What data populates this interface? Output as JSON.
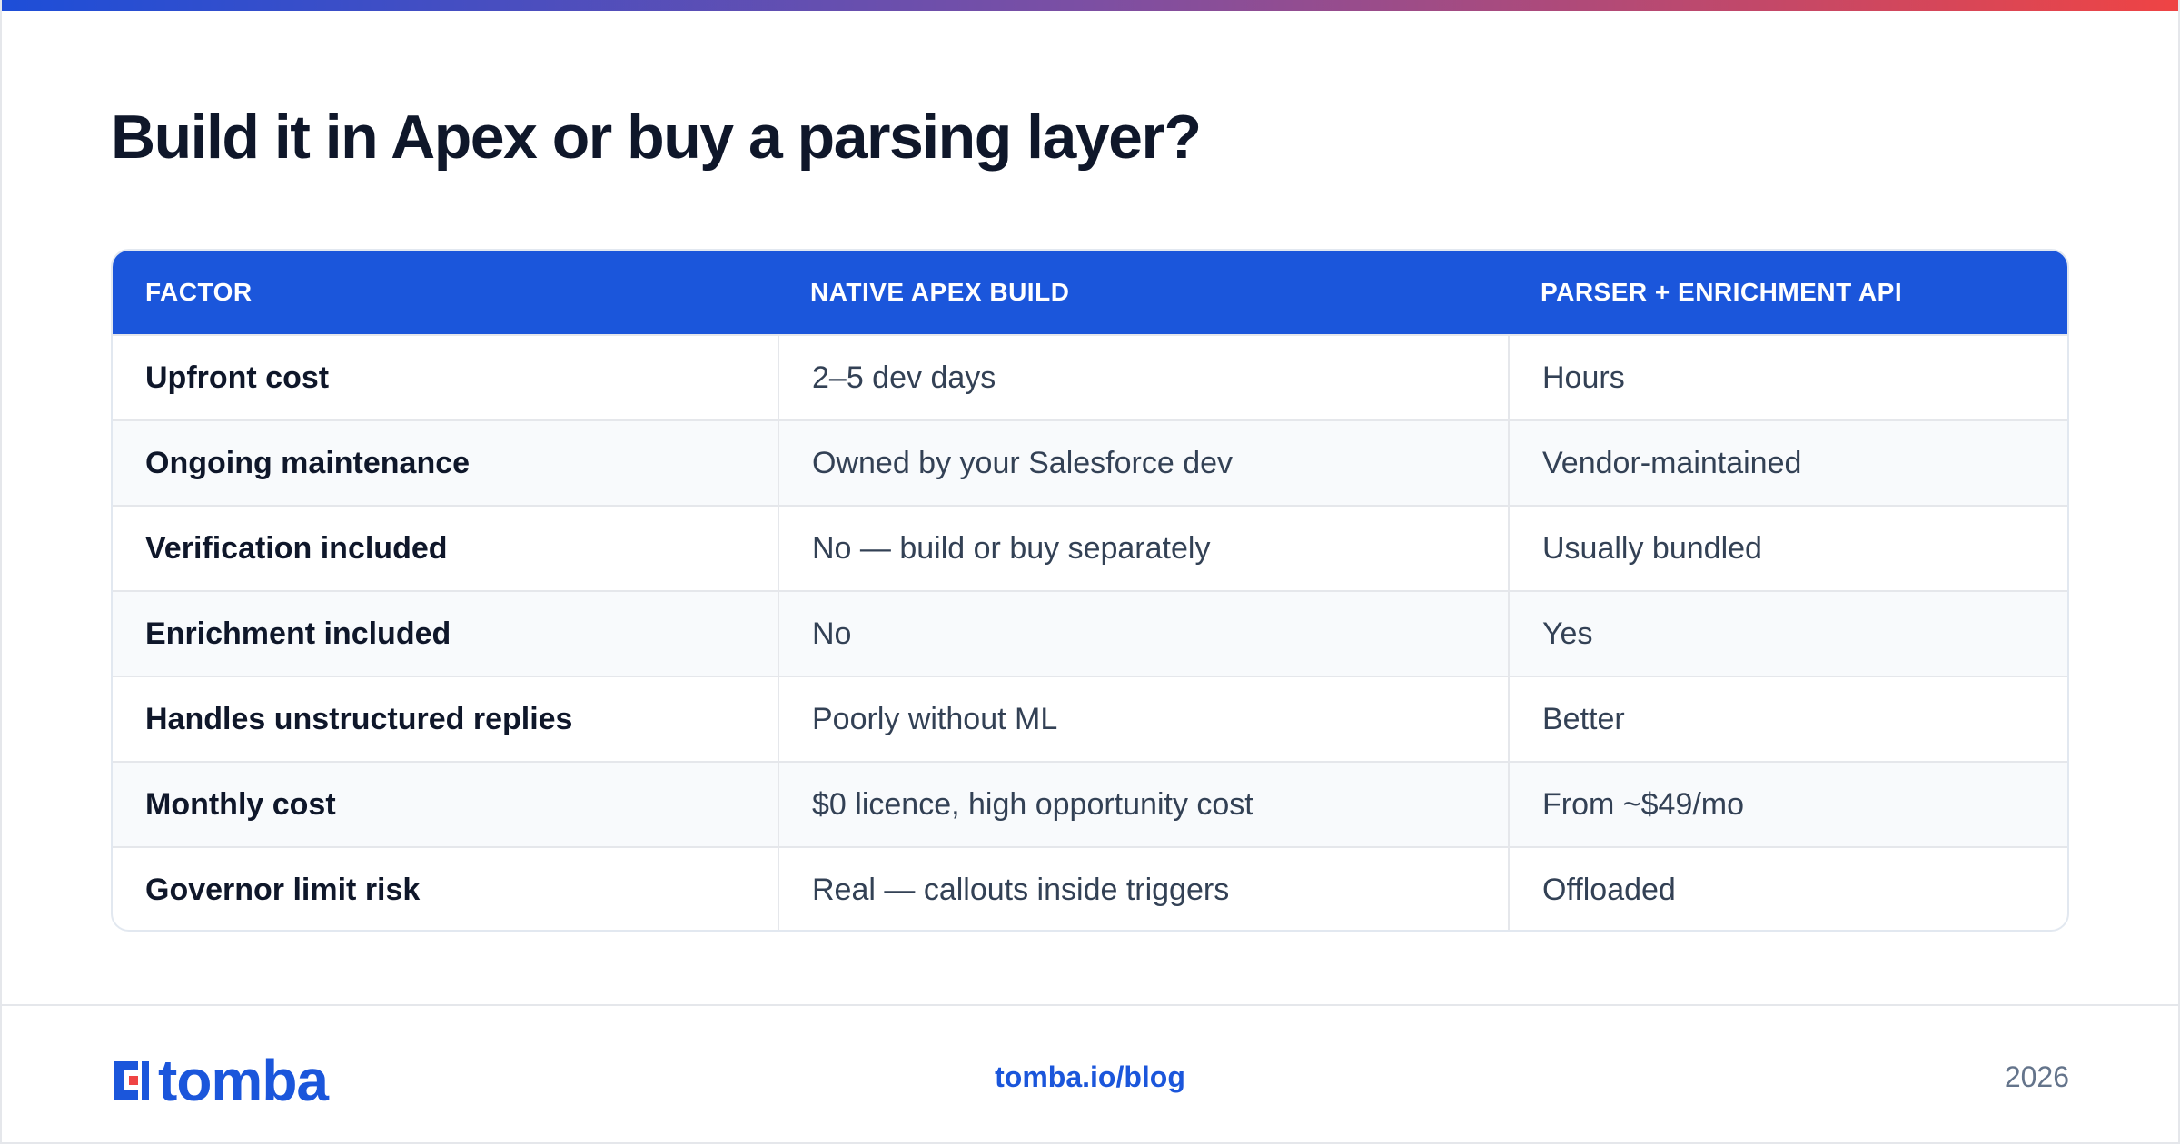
{
  "title": "Build it in Apex or buy a parsing layer?",
  "table": {
    "headers": [
      "FACTOR",
      "NATIVE APEX BUILD",
      "PARSER + ENRICHMENT API"
    ],
    "rows": [
      {
        "factor": "Upfront cost",
        "native": "2–5 dev days",
        "api": "Hours"
      },
      {
        "factor": "Ongoing maintenance",
        "native": "Owned by your Salesforce dev",
        "api": "Vendor-maintained"
      },
      {
        "factor": "Verification included",
        "native": "No — build or buy separately",
        "api": "Usually bundled"
      },
      {
        "factor": "Enrichment included",
        "native": "No",
        "api": "Yes"
      },
      {
        "factor": "Handles unstructured replies",
        "native": "Poorly without ML",
        "api": "Better"
      },
      {
        "factor": "Monthly cost",
        "native": "$0 licence, high opportunity cost",
        "api": "From ~$49/mo"
      },
      {
        "factor": "Governor limit risk",
        "native": "Real — callouts inside triggers",
        "api": "Offloaded"
      }
    ]
  },
  "footer": {
    "logo_text": "tomba",
    "logo_icon": "tomba-logo-icon",
    "url": "tomba.io/blog",
    "year": "2026"
  },
  "colors": {
    "accent": "#1b56db",
    "gradient_start": "#1d4ed8",
    "gradient_end": "#ef4444",
    "logo_red": "#ef4444"
  }
}
